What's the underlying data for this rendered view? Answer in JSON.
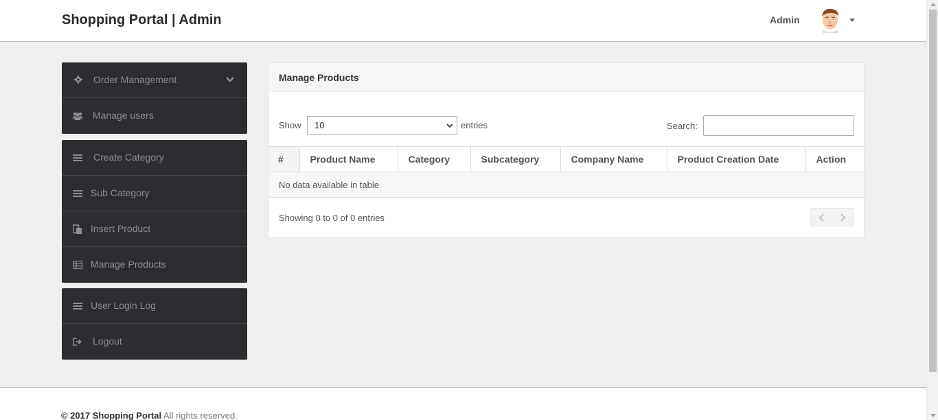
{
  "header": {
    "brand": "Shopping Portal | Admin",
    "user_label": "Admin"
  },
  "sidebar": {
    "group1": [
      {
        "label": "Order Management",
        "icon": "gear-icon"
      },
      {
        "label": "Manage users",
        "icon": "users-icon"
      }
    ],
    "group2": [
      {
        "label": "Create Category",
        "icon": "list-icon"
      },
      {
        "label": "Sub Category",
        "icon": "list-icon"
      },
      {
        "label": "Insert Product",
        "icon": "paste-icon"
      },
      {
        "label": "Manage Products",
        "icon": "table-icon"
      }
    ],
    "group3": [
      {
        "label": "User Login Log",
        "icon": "list-icon"
      },
      {
        "label": "Logout",
        "icon": "sign-out-icon"
      }
    ]
  },
  "panel": {
    "title": "Manage Products",
    "show_label": "Show",
    "length_value": "10",
    "entries_label": "entries",
    "search_label": "Search:",
    "search_value": "",
    "columns": [
      "#",
      "Product Name",
      "Category",
      "Subcategory",
      "Company Name",
      "Product Creation Date",
      "Action"
    ],
    "empty_message": "No data available in table",
    "info": "Showing 0 to 0 of 0 entries"
  },
  "footer": {
    "copyright": "© 2017 Shopping Portal",
    "rights": "All rights reserved."
  },
  "colors": {
    "sidebar_bg": "#2d2c31",
    "sidebar_text": "#8e8d92",
    "page_bg": "#efefef"
  }
}
